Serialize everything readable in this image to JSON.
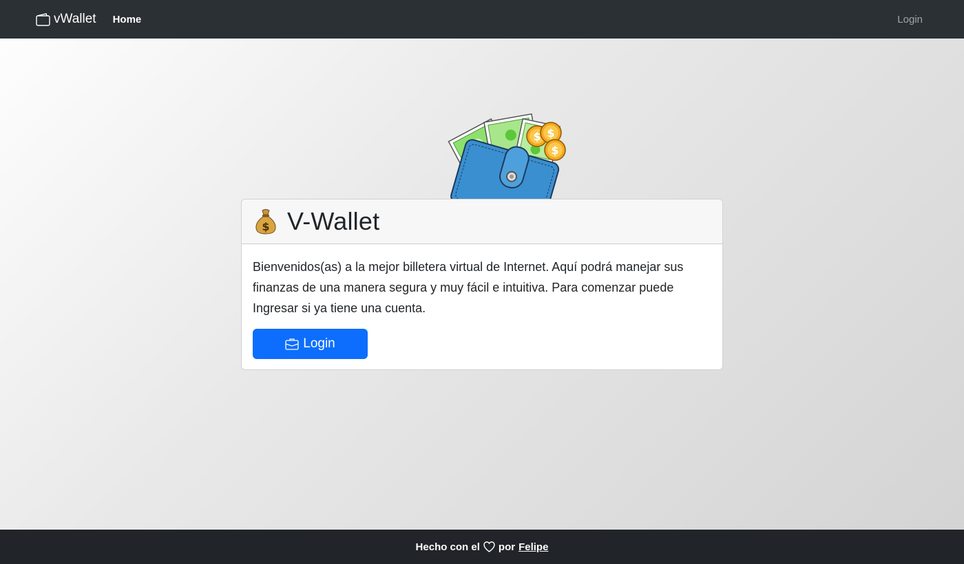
{
  "navbar": {
    "brand": "vWallet",
    "brand_icon": "wallet-icon",
    "home_label": "Home",
    "login_label": "Login"
  },
  "hero": {
    "icon": "wallet-with-cash-and-coins"
  },
  "card": {
    "icon": "money-bag-icon",
    "title": "V-Wallet",
    "text": "Bienvenidos(as) a la mejor billetera virtual de Internet. Aquí podrá manejar sus finanzas de una manera segura y muy fácil e intuitiva. Para comenzar puede Ingresar si ya tiene una cuenta.",
    "button_label": "Login",
    "button_icon": "briefcase-icon"
  },
  "footer": {
    "text_before": "Hecho con el",
    "heart_icon": "heart-icon",
    "text_after": "por",
    "author": "Felipe"
  },
  "colors": {
    "navbar_bg": "#2b3035",
    "footer_bg": "#212529",
    "primary": "#0d6efd"
  }
}
